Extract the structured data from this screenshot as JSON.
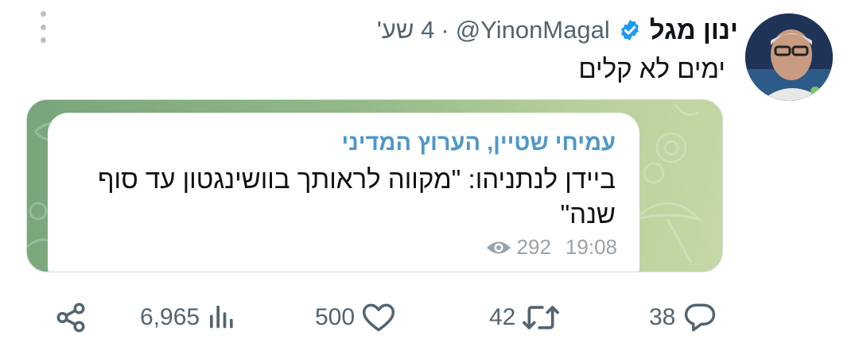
{
  "author": {
    "name": "ינון מגל",
    "handle": "@YinonMagal",
    "time": "4 שע'",
    "separator": "·"
  },
  "tweet": {
    "text": "ימים לא קלים"
  },
  "embedded_post": {
    "author": "עמיחי שטיין, הערוץ המדיני",
    "text": "ביידן לנתניהו: \"מקווה לראותך בוושינגטון עד סוף שנה\"",
    "views": "292",
    "time": "19:08"
  },
  "actions": {
    "replies": "38",
    "retweets": "42",
    "likes": "500",
    "views": "6,965"
  },
  "colors": {
    "verified": "#1d9bf0",
    "muted": "#536471",
    "channel_link": "#4f97c9"
  },
  "icons": [
    "verified-badge-icon",
    "more-icon",
    "eye-icon",
    "reply-icon",
    "retweet-icon",
    "like-icon",
    "views-icon",
    "share-icon"
  ]
}
